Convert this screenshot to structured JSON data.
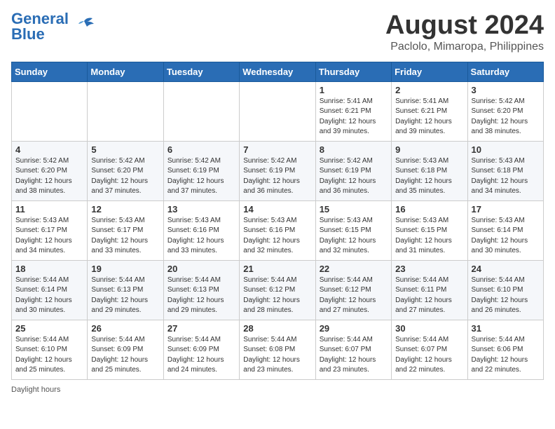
{
  "header": {
    "logo_line1": "General",
    "logo_line2": "Blue",
    "month_title": "August 2024",
    "location": "Paclolo, Mimaropa, Philippines"
  },
  "weekdays": [
    "Sunday",
    "Monday",
    "Tuesday",
    "Wednesday",
    "Thursday",
    "Friday",
    "Saturday"
  ],
  "weeks": [
    [
      {
        "day": "",
        "info": ""
      },
      {
        "day": "",
        "info": ""
      },
      {
        "day": "",
        "info": ""
      },
      {
        "day": "",
        "info": ""
      },
      {
        "day": "1",
        "info": "Sunrise: 5:41 AM\nSunset: 6:21 PM\nDaylight: 12 hours\nand 39 minutes."
      },
      {
        "day": "2",
        "info": "Sunrise: 5:41 AM\nSunset: 6:21 PM\nDaylight: 12 hours\nand 39 minutes."
      },
      {
        "day": "3",
        "info": "Sunrise: 5:42 AM\nSunset: 6:20 PM\nDaylight: 12 hours\nand 38 minutes."
      }
    ],
    [
      {
        "day": "4",
        "info": "Sunrise: 5:42 AM\nSunset: 6:20 PM\nDaylight: 12 hours\nand 38 minutes."
      },
      {
        "day": "5",
        "info": "Sunrise: 5:42 AM\nSunset: 6:20 PM\nDaylight: 12 hours\nand 37 minutes."
      },
      {
        "day": "6",
        "info": "Sunrise: 5:42 AM\nSunset: 6:19 PM\nDaylight: 12 hours\nand 37 minutes."
      },
      {
        "day": "7",
        "info": "Sunrise: 5:42 AM\nSunset: 6:19 PM\nDaylight: 12 hours\nand 36 minutes."
      },
      {
        "day": "8",
        "info": "Sunrise: 5:42 AM\nSunset: 6:19 PM\nDaylight: 12 hours\nand 36 minutes."
      },
      {
        "day": "9",
        "info": "Sunrise: 5:43 AM\nSunset: 6:18 PM\nDaylight: 12 hours\nand 35 minutes."
      },
      {
        "day": "10",
        "info": "Sunrise: 5:43 AM\nSunset: 6:18 PM\nDaylight: 12 hours\nand 34 minutes."
      }
    ],
    [
      {
        "day": "11",
        "info": "Sunrise: 5:43 AM\nSunset: 6:17 PM\nDaylight: 12 hours\nand 34 minutes."
      },
      {
        "day": "12",
        "info": "Sunrise: 5:43 AM\nSunset: 6:17 PM\nDaylight: 12 hours\nand 33 minutes."
      },
      {
        "day": "13",
        "info": "Sunrise: 5:43 AM\nSunset: 6:16 PM\nDaylight: 12 hours\nand 33 minutes."
      },
      {
        "day": "14",
        "info": "Sunrise: 5:43 AM\nSunset: 6:16 PM\nDaylight: 12 hours\nand 32 minutes."
      },
      {
        "day": "15",
        "info": "Sunrise: 5:43 AM\nSunset: 6:15 PM\nDaylight: 12 hours\nand 32 minutes."
      },
      {
        "day": "16",
        "info": "Sunrise: 5:43 AM\nSunset: 6:15 PM\nDaylight: 12 hours\nand 31 minutes."
      },
      {
        "day": "17",
        "info": "Sunrise: 5:43 AM\nSunset: 6:14 PM\nDaylight: 12 hours\nand 30 minutes."
      }
    ],
    [
      {
        "day": "18",
        "info": "Sunrise: 5:44 AM\nSunset: 6:14 PM\nDaylight: 12 hours\nand 30 minutes."
      },
      {
        "day": "19",
        "info": "Sunrise: 5:44 AM\nSunset: 6:13 PM\nDaylight: 12 hours\nand 29 minutes."
      },
      {
        "day": "20",
        "info": "Sunrise: 5:44 AM\nSunset: 6:13 PM\nDaylight: 12 hours\nand 29 minutes."
      },
      {
        "day": "21",
        "info": "Sunrise: 5:44 AM\nSunset: 6:12 PM\nDaylight: 12 hours\nand 28 minutes."
      },
      {
        "day": "22",
        "info": "Sunrise: 5:44 AM\nSunset: 6:12 PM\nDaylight: 12 hours\nand 27 minutes."
      },
      {
        "day": "23",
        "info": "Sunrise: 5:44 AM\nSunset: 6:11 PM\nDaylight: 12 hours\nand 27 minutes."
      },
      {
        "day": "24",
        "info": "Sunrise: 5:44 AM\nSunset: 6:10 PM\nDaylight: 12 hours\nand 26 minutes."
      }
    ],
    [
      {
        "day": "25",
        "info": "Sunrise: 5:44 AM\nSunset: 6:10 PM\nDaylight: 12 hours\nand 25 minutes."
      },
      {
        "day": "26",
        "info": "Sunrise: 5:44 AM\nSunset: 6:09 PM\nDaylight: 12 hours\nand 25 minutes."
      },
      {
        "day": "27",
        "info": "Sunrise: 5:44 AM\nSunset: 6:09 PM\nDaylight: 12 hours\nand 24 minutes."
      },
      {
        "day": "28",
        "info": "Sunrise: 5:44 AM\nSunset: 6:08 PM\nDaylight: 12 hours\nand 23 minutes."
      },
      {
        "day": "29",
        "info": "Sunrise: 5:44 AM\nSunset: 6:07 PM\nDaylight: 12 hours\nand 23 minutes."
      },
      {
        "day": "30",
        "info": "Sunrise: 5:44 AM\nSunset: 6:07 PM\nDaylight: 12 hours\nand 22 minutes."
      },
      {
        "day": "31",
        "info": "Sunrise: 5:44 AM\nSunset: 6:06 PM\nDaylight: 12 hours\nand 22 minutes."
      }
    ]
  ],
  "footer": {
    "daylight_label": "Daylight hours"
  }
}
